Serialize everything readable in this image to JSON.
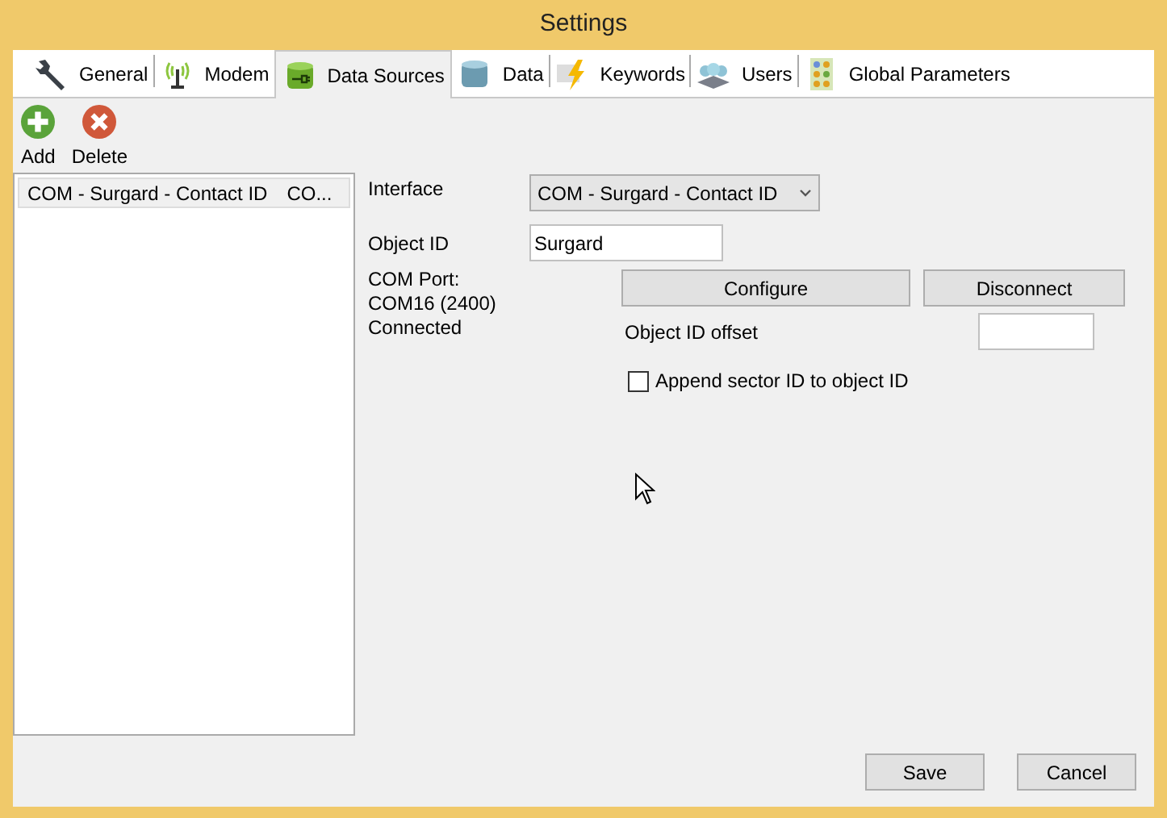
{
  "window": {
    "title": "Settings"
  },
  "tabs": [
    {
      "label": "General",
      "kind": "wrench",
      "selected": false
    },
    {
      "label": "Modem",
      "kind": "antenna",
      "selected": false
    },
    {
      "label": "Data Sources",
      "kind": "plugdb",
      "selected": true
    },
    {
      "label": "Data",
      "kind": "database",
      "selected": false
    },
    {
      "label": "Keywords",
      "kind": "lightning",
      "selected": false
    },
    {
      "label": "Users",
      "kind": "users",
      "selected": false
    },
    {
      "label": "Global Parameters",
      "kind": "grid",
      "selected": false
    }
  ],
  "toolbar": [
    {
      "label": "Add",
      "kind": "add"
    },
    {
      "label": "Delete",
      "kind": "delete"
    }
  ],
  "sources": [
    {
      "name": "COM - Surgard - Contact ID",
      "column_2": "CO...",
      "selected": true
    }
  ],
  "form": {
    "interface_label": "Interface",
    "interface_value": "COM - Surgard - Contact ID",
    "object_id_label": "Object ID",
    "object_id_value": "Surgard",
    "status_lines": [
      "COM Port:",
      "COM16 (2400)",
      "Connected"
    ],
    "configure": "Configure",
    "disconnect": "Disconnect",
    "offset_label": "Object ID offset",
    "append": {
      "label": "Append sector ID to object ID",
      "checked": false
    }
  },
  "buttons": [
    "Save",
    "Cancel"
  ]
}
